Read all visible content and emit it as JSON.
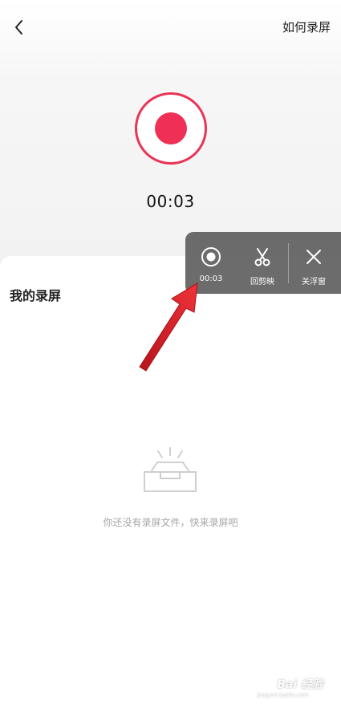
{
  "header": {
    "back_icon": "chevron-left-icon",
    "help_link": "如何录屏"
  },
  "recorder": {
    "accent_color": "#ef2f55",
    "elapsed": "00:03"
  },
  "my_recordings": {
    "title": "我的录屏",
    "empty_icon": "empty-box-icon",
    "empty_message": "你还没有录屏文件，快来录屏吧"
  },
  "floating_panel": {
    "items": [
      {
        "icon": "record-icon",
        "label": "00:03"
      },
      {
        "icon": "scissors-icon",
        "label": "回剪映"
      },
      {
        "icon": "close-icon",
        "label": "关浮窗"
      }
    ]
  },
  "annotation": {
    "arrow_color": "#e0202a"
  },
  "watermark": {
    "text": "Bai 经验",
    "url": "jingyan.baidu.com"
  }
}
